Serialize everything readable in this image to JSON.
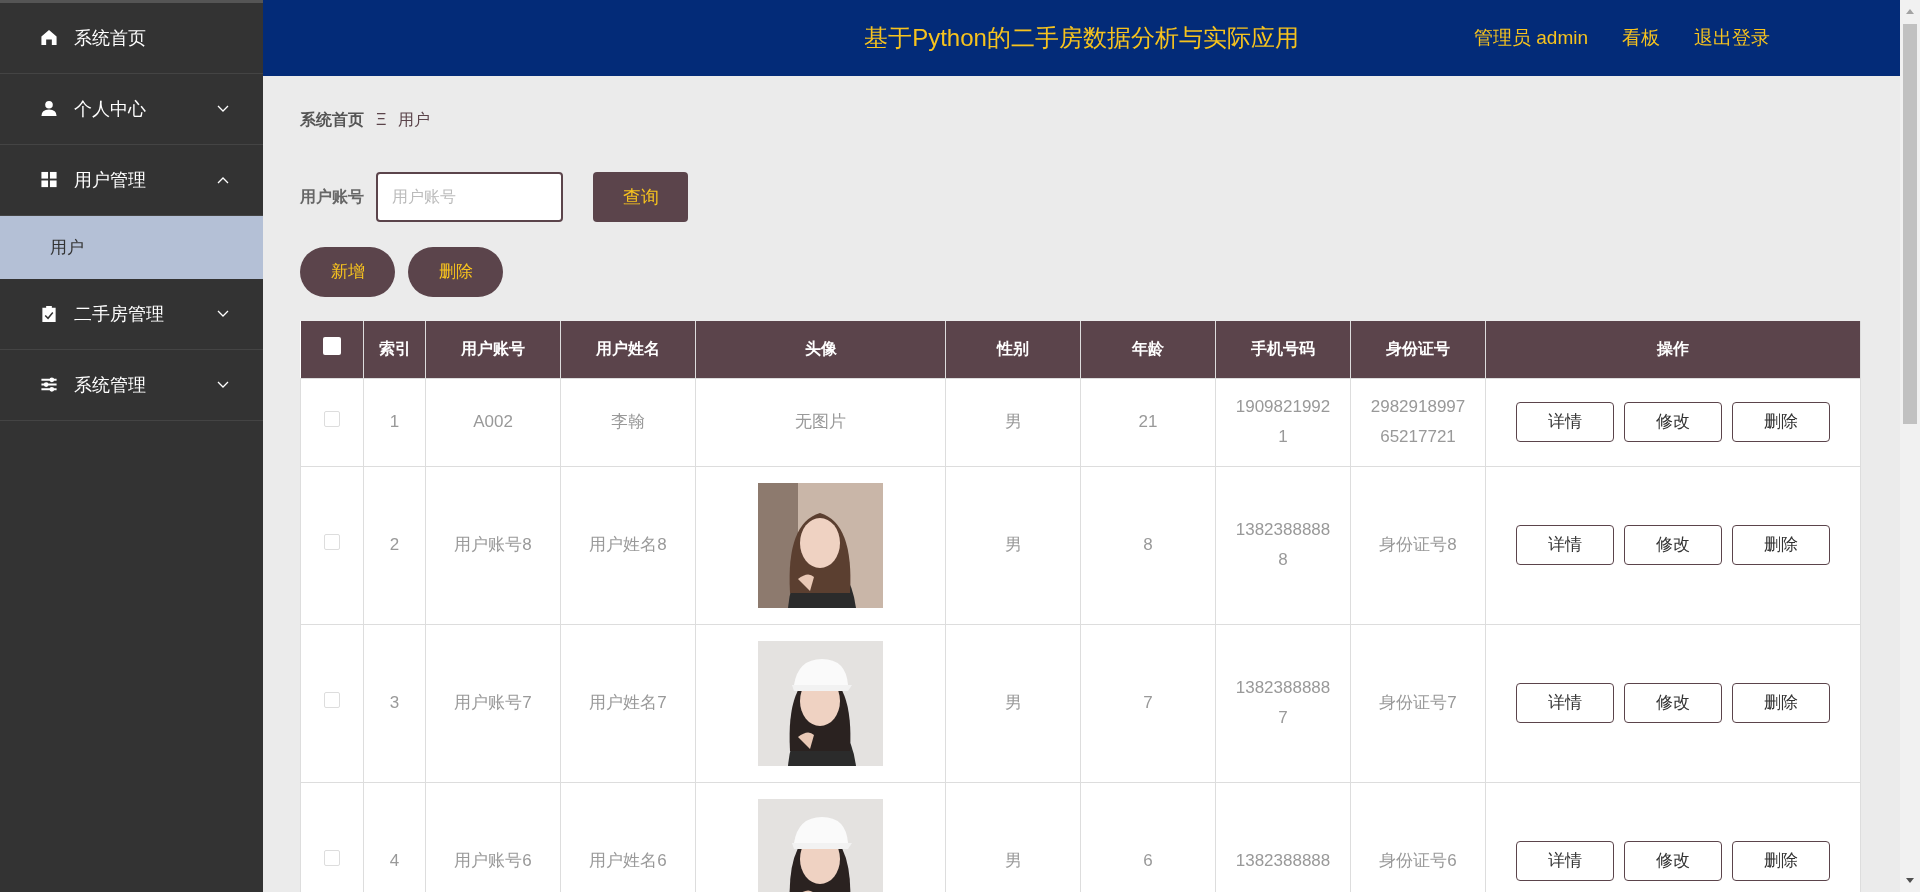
{
  "sidebar": {
    "items": [
      {
        "label": "系统首页"
      },
      {
        "label": "个人中心",
        "expanded": false
      },
      {
        "label": "用户管理",
        "expanded": true,
        "children": [
          {
            "label": "用户",
            "selected": true
          }
        ]
      },
      {
        "label": "二手房管理",
        "expanded": false
      },
      {
        "label": "系统管理",
        "expanded": false
      }
    ]
  },
  "header": {
    "title": "基于Python的二手房数据分析与实际应用",
    "links": [
      "管理员 admin",
      "看板",
      "退出登录"
    ]
  },
  "breadcrumb": {
    "home": "系统首页",
    "separator": "Ξ",
    "current": "用户"
  },
  "search": {
    "label": "用户账号",
    "placeholder": "用户账号",
    "button": "查询"
  },
  "actions": [
    "新增",
    "删除"
  ],
  "table": {
    "select_all": {
      "checked": false
    },
    "columns": [
      "索引",
      "用户账号",
      "用户姓名",
      "头像",
      "性别",
      "年龄",
      "手机号码",
      "身份证号",
      "操作"
    ],
    "rows": [
      {
        "checked": false,
        "cells": [
          "1",
          "A002",
          "李翰",
          {
            "kind": "text",
            "text": "无图片"
          },
          "男",
          "21",
          "19098219921",
          "298291899765217721"
        ],
        "buttons": [
          "详情",
          "修改",
          "删除"
        ]
      },
      {
        "checked": false,
        "cells": [
          "2",
          "用户账号8",
          "用户姓名8",
          {
            "kind": "picture"
          },
          "男",
          "8",
          "13823888888",
          "身份证号8"
        ],
        "buttons": [
          "详情",
          "修改",
          "删除"
        ]
      },
      {
        "checked": false,
        "cells": [
          "3",
          "用户账号7",
          "用户姓名7",
          {
            "kind": "picture"
          },
          "男",
          "7",
          "13823888887",
          "身份证号7"
        ],
        "buttons": [
          "详情",
          "修改",
          "删除"
        ]
      },
      {
        "checked": false,
        "cells": [
          "4",
          "用户账号6",
          "用户姓名6",
          {
            "kind": "picture"
          },
          "男",
          "6",
          "1382388888",
          "身份证号6"
        ],
        "buttons": [
          "详情",
          "修改",
          "删除"
        ]
      }
    ]
  }
}
